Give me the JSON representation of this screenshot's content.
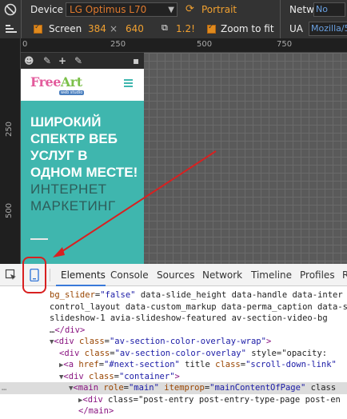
{
  "toolbar": {
    "device_label": "Device",
    "device_value": "LG Optimus L70",
    "orientation_label": "Portrait",
    "screen_label": "Screen",
    "width_value": "384",
    "times": "×",
    "height_value": "640",
    "scale_value": "1.2!",
    "zoom_label": "Zoom to fit",
    "network_label": "Network",
    "network_value": "No",
    "ua_label": "UA",
    "ua_value": "Mozilla/5"
  },
  "rulers": {
    "h_ticks": [
      "0",
      "250",
      "500",
      "750"
    ],
    "v_ticks": [
      "250",
      "500"
    ]
  },
  "phone": {
    "logo_free": "Free",
    "logo_art": "Art",
    "logo_sub": "web studio",
    "hero_text": "ШИРОКИЙ СПЕКТР ВЕБ УСЛУГ В ОДНОМ МЕСТЕ!",
    "hero_text2": "ИНТЕРНЕТ МАРКЕТИНГ"
  },
  "devtools": {
    "tabs": [
      "Elements",
      "Console",
      "Sources",
      "Network",
      "Timeline",
      "Profiles",
      "R"
    ],
    "code_lines": [
      {
        "indent": 62,
        "text": "bg_slider=\"false\" data-slide_height data-handle data-inter"
      },
      {
        "indent": 62,
        "text": "control_layout data-custom_markup data-perma_caption data-s"
      },
      {
        "indent": 62,
        "text": "slideshow-1  avia-slideshow-featured   av-section-video-bg"
      },
      {
        "indent": 62,
        "text": "…</div>"
      },
      {
        "indent": 62,
        "text": "▼<div class=\"av-section-color-overlay-wrap\">"
      },
      {
        "indent": 74,
        "text": "<div class=\"av-section-color-overlay\" style=\"opacity:"
      },
      {
        "indent": 74,
        "text": "▶<a href=\"#next-section\" title class=\"scroll-down-link\""
      },
      {
        "indent": 74,
        "text": "▼<div class=\"container\">"
      },
      {
        "indent": 86,
        "text": "▼<main role=\"main\" itemprop=\"mainContentOfPage\" class"
      },
      {
        "indent": 98,
        "text": "▶<div class=\"post-entry post-entry-type-page post-en"
      },
      {
        "indent": 98,
        "text": "</main>"
      }
    ]
  }
}
